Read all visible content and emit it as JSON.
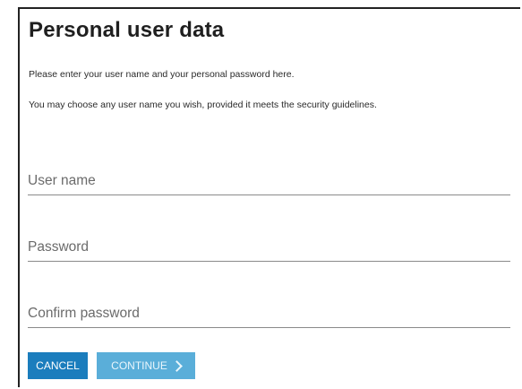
{
  "dialog": {
    "title": "Personal user data",
    "instructions": [
      "Please enter your user name and your personal password here.",
      "You may choose any user name you wish, provided it meets the security guidelines."
    ]
  },
  "form": {
    "user_name": {
      "value": "",
      "placeholder": "User name"
    },
    "password": {
      "value": "",
      "placeholder": "Password"
    },
    "confirm_password": {
      "value": "",
      "placeholder": "Confirm password"
    }
  },
  "actions": {
    "cancel_label": "CANCEL",
    "continue_label": "CONTINUE",
    "continue_icon": "chevron-right-icon"
  },
  "colors": {
    "cancel_bg": "#1b7dbd",
    "continue_bg": "#5aaed9"
  }
}
